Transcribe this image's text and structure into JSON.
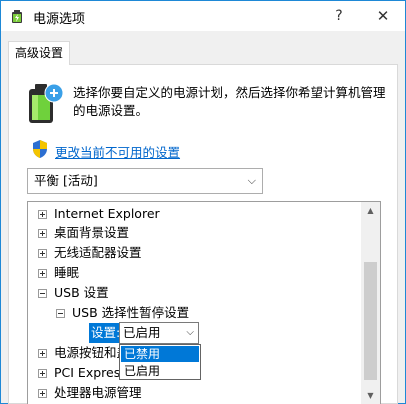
{
  "window": {
    "title": "电源选项",
    "help_label": "?",
    "close_label": "✕"
  },
  "tab": {
    "label": "高级设置"
  },
  "description": "选择你要自定义的电源计划，然后选择你希望计算机管理的电源设置。",
  "link_text": "更改当前不可用的设置",
  "plan_select": {
    "value": "平衡 [活动]"
  },
  "tree": {
    "items": [
      {
        "label": "Internet Explorer",
        "expander": "plus"
      },
      {
        "label": "桌面背景设置",
        "expander": "plus"
      },
      {
        "label": "无线适配器设置",
        "expander": "plus"
      },
      {
        "label": "睡眠",
        "expander": "plus"
      },
      {
        "label": "USB 设置",
        "expander": "minus"
      },
      {
        "label": "USB 选择性暂停设置",
        "expander": "minus"
      },
      {
        "label": "电源按钮和盖",
        "expander": "plus"
      },
      {
        "label": "PCI Express",
        "expander": "plus"
      },
      {
        "label": "处理器电源管理",
        "expander": "plus"
      }
    ],
    "setting_label": "设置:",
    "setting_value": "已启用"
  },
  "dropdown_options": [
    "已禁用",
    "已启用"
  ],
  "colors": {
    "accent": "#0078d7",
    "link": "#0066cc",
    "window_border": "#1e88d6"
  }
}
